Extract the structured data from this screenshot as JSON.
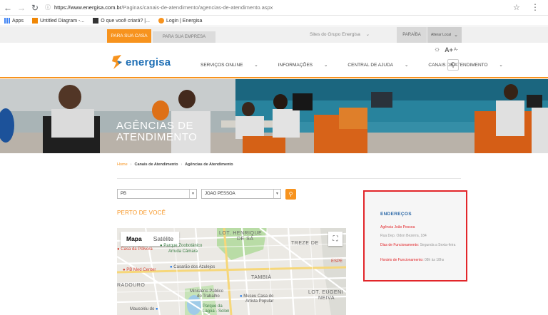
{
  "browser": {
    "url_host": "https://www.energisa.com.br",
    "url_path": "/Paginas/canais-de-atendimento/agencias-de-atendimento.aspx",
    "bookmarks": [
      "Apps",
      "Untitled Diagram -...",
      "O que você criará? |...",
      "Login | Energisa"
    ]
  },
  "topbar": {
    "tab_home": "PARA SUA CASA",
    "tab_business": "PARA SUA EMPRESA",
    "group_sites": "Sites do Grupo Energisa",
    "state": "PARAÍBA",
    "location": "Alterar Local"
  },
  "header": {
    "logo_text": "energisa",
    "font_increase": "A+",
    "font_decrease": "A-",
    "menu": [
      "SERVIÇOS ONLINE",
      "INFORMAÇÕES",
      "CENTRAL DE AJUDA",
      "CANAIS DE ATENDIMENTO"
    ]
  },
  "hero": {
    "title_line1": "AGÊNCIAS DE",
    "title_line2": "ATENDIMENTO"
  },
  "breadcrumb": [
    "Home",
    "Canais de Atendimento",
    "Agências de Atendimento"
  ],
  "filters": {
    "state_value": "PB",
    "city_value": "JOAO PESSOA"
  },
  "near_title": "PERTO DE VOCÊ",
  "map": {
    "tab_map": "Mapa",
    "tab_satellite": "Satélite",
    "labels": {
      "lot_henrique_1": "LOT. HENRIQUE",
      "lot_henrique_2": "DE SÁ",
      "treze": "TREZE DE",
      "casa_polvora": "Casa da Pólvora",
      "parque_zoo": "Parque Zoobotânico",
      "arruda_camara": "Arruda Câmara",
      "pb_med": "PB Med Center",
      "casarao": "Casarão dos Azulejos",
      "tambia": "TAMBIÁ",
      "esp": "ESPE",
      "radouro": "RADOURO",
      "ministerio": "Ministério Público",
      "do_trabalho": "do Trabalho",
      "museu": "Museu Casa do",
      "artista": "Artista Popular",
      "lot_eugenio_1": "LOT. EUGENI",
      "lot_eugenio_2": "NEIVA",
      "mausoleu": "Mausoléu do",
      "parque_lagoa_1": "Parque da",
      "parque_lagoa_2": "Lagoa - Solon"
    }
  },
  "address_box": {
    "title": "ENDEREÇOS",
    "agency_name": "Agência João Pessoa",
    "street": "Rua Dep. Odon Bezerra, 184",
    "days_label": "Dias de Funcionamento:",
    "days_value": "Segunda a Sexta-feira",
    "hours_label": "Horário de Funcionamento:",
    "hours_value": "08h às 18hs"
  },
  "colors": {
    "brand_orange": "#f7931e",
    "brand_blue": "#1f6fb5",
    "highlight_red": "#e2262a"
  }
}
